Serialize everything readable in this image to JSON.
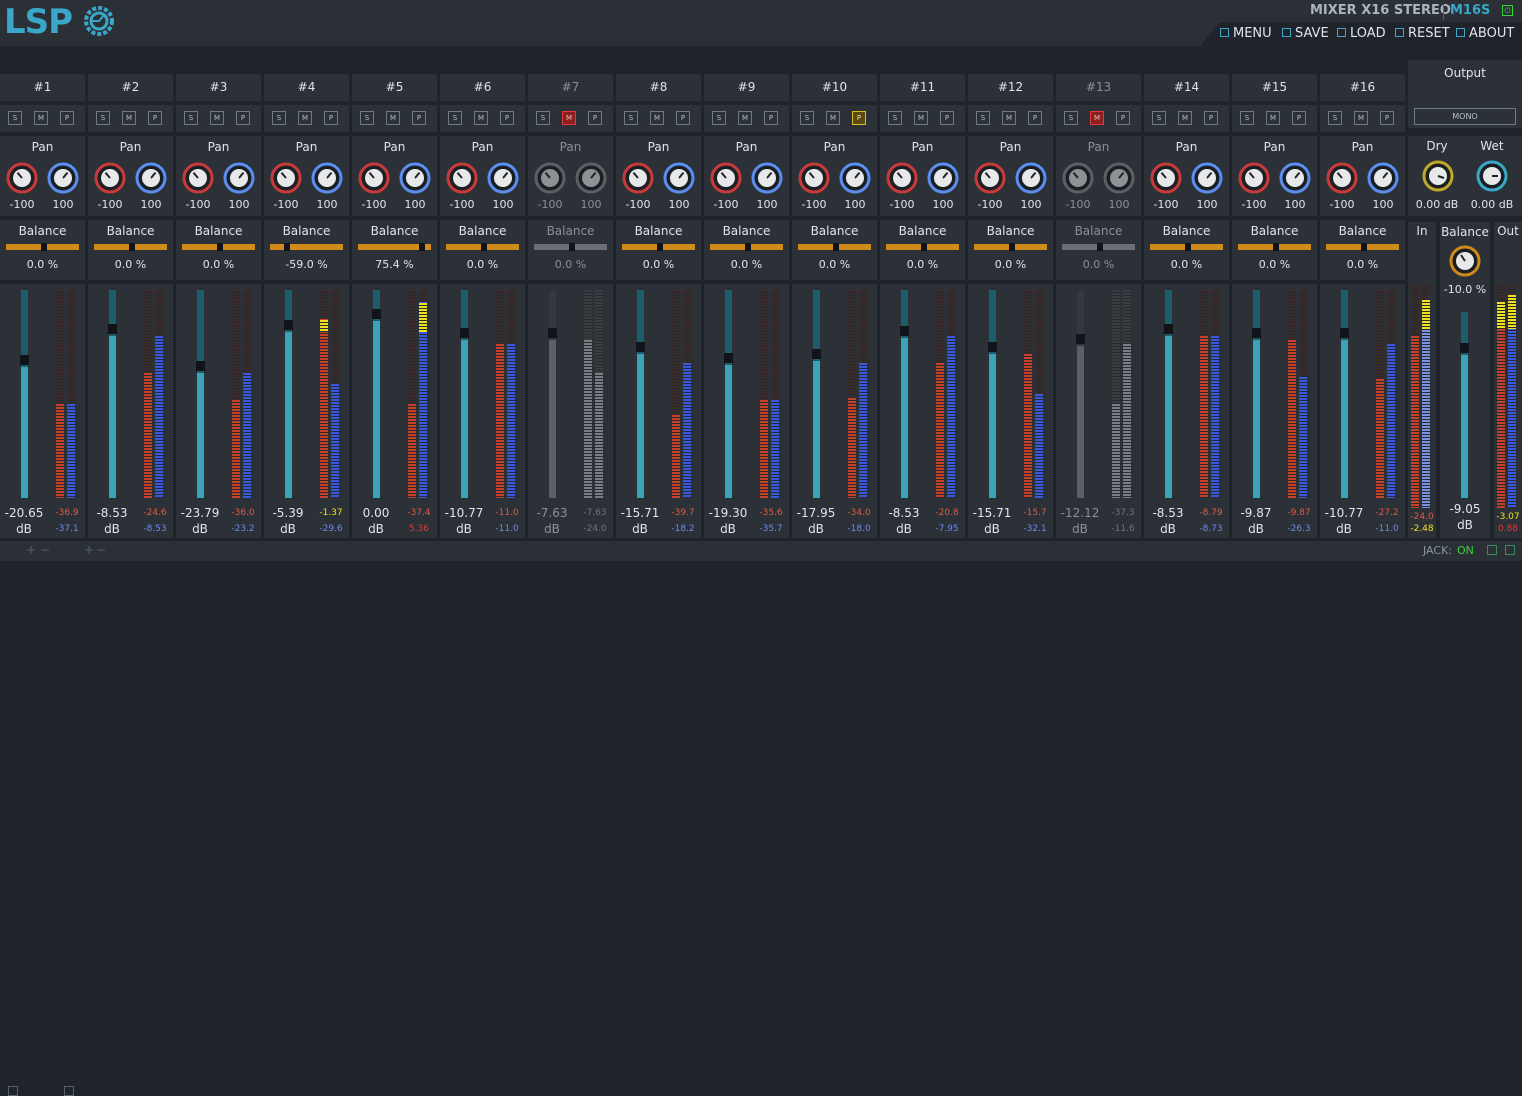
{
  "app": {
    "logo": "LSP",
    "title": "MIXER X16 STEREO",
    "model": "M16S"
  },
  "menu": {
    "menu_label": "MENU",
    "save_label": "SAVE",
    "load_label": "LOAD",
    "reset_label": "RESET",
    "about_label": "ABOUT"
  },
  "colors": {
    "accent": "#3aa7c9",
    "pan_left": "#c83a3a",
    "pan_right": "#5c8df0",
    "balance": "#d08a1a",
    "fader": "#39a3b8",
    "solo_active": "#d8c020",
    "mute_active": "#e03a3a"
  },
  "strip_buttons": {
    "solo": "S",
    "mute": "M",
    "phase": "P"
  },
  "strip_labels": {
    "pan": "Pan",
    "balance": "Balance",
    "db": "dB"
  },
  "channels": [
    {
      "name": "#1",
      "pan_l": "-100",
      "pan_r": "100",
      "balance": "0.0 %",
      "balance_frac": 0.5,
      "gain": "-20.65",
      "fader_frac": 0.63,
      "peak_l": "-36.9",
      "peak_r": "-37.1",
      "lvl_l": 0.45,
      "lvl_r": 0.45,
      "mute": false,
      "solo": false,
      "enabled": true
    },
    {
      "name": "#2",
      "pan_l": "-100",
      "pan_r": "100",
      "balance": "0.0 %",
      "balance_frac": 0.5,
      "gain": "-8.53",
      "fader_frac": 0.78,
      "peak_l": "-24.6",
      "peak_r": "-8.53",
      "lvl_l": 0.6,
      "lvl_r": 0.78,
      "mute": false,
      "solo": false,
      "enabled": true
    },
    {
      "name": "#3",
      "pan_l": "-100",
      "pan_r": "100",
      "balance": "0.0 %",
      "balance_frac": 0.5,
      "gain": "-23.79",
      "fader_frac": 0.6,
      "peak_l": "-36.0",
      "peak_r": "-23.2",
      "lvl_l": 0.47,
      "lvl_r": 0.6,
      "mute": false,
      "solo": false,
      "enabled": true
    },
    {
      "name": "#4",
      "pan_l": "-100",
      "pan_r": "100",
      "balance": "-59.0 %",
      "balance_frac": 0.2,
      "gain": "-5.39",
      "fader_frac": 0.8,
      "peak_l": "-1.37",
      "peak_r": "-29.6",
      "lvl_l": 0.86,
      "lvl_r": 0.55,
      "mute": false,
      "solo": false,
      "enabled": true
    },
    {
      "name": "#5",
      "pan_l": "-100",
      "pan_r": "100",
      "balance": "75.4 %",
      "balance_frac": 0.88,
      "gain": "0.00",
      "fader_frac": 0.85,
      "peak_l": "-37.4",
      "peak_r": "5.36",
      "lvl_l": 0.45,
      "lvl_r": 0.94,
      "mute": false,
      "solo": false,
      "enabled": true
    },
    {
      "name": "#6",
      "pan_l": "-100",
      "pan_r": "100",
      "balance": "0.0 %",
      "balance_frac": 0.5,
      "gain": "-10.77",
      "fader_frac": 0.76,
      "peak_l": "-11.0",
      "peak_r": "-11.0",
      "lvl_l": 0.74,
      "lvl_r": 0.74,
      "mute": false,
      "solo": false,
      "enabled": true
    },
    {
      "name": "#7",
      "pan_l": "-100",
      "pan_r": "100",
      "balance": "0.0 %",
      "balance_frac": 0.5,
      "gain": "-7.63",
      "fader_frac": 0.76,
      "peak_l": "-7.63",
      "peak_r": "-24.0",
      "lvl_l": 0.76,
      "lvl_r": 0.6,
      "mute": true,
      "solo": false,
      "enabled": false
    },
    {
      "name": "#8",
      "pan_l": "-100",
      "pan_r": "100",
      "balance": "0.0 %",
      "balance_frac": 0.5,
      "gain": "-15.71",
      "fader_frac": 0.69,
      "peak_l": "-39.7",
      "peak_r": "-18.2",
      "lvl_l": 0.4,
      "lvl_r": 0.65,
      "mute": false,
      "solo": false,
      "enabled": true
    },
    {
      "name": "#9",
      "pan_l": "-100",
      "pan_r": "100",
      "balance": "0.0 %",
      "balance_frac": 0.5,
      "gain": "-19.30",
      "fader_frac": 0.64,
      "peak_l": "-35.6",
      "peak_r": "-35.7",
      "lvl_l": 0.47,
      "lvl_r": 0.47,
      "mute": false,
      "solo": false,
      "enabled": true
    },
    {
      "name": "#10",
      "pan_l": "-100",
      "pan_r": "100",
      "balance": "0.0 %",
      "balance_frac": 0.5,
      "gain": "-17.95",
      "fader_frac": 0.66,
      "peak_l": "-34.0",
      "peak_r": "-18.0",
      "lvl_l": 0.48,
      "lvl_r": 0.65,
      "mute": false,
      "solo": false,
      "phase": true,
      "enabled": true
    },
    {
      "name": "#11",
      "pan_l": "-100",
      "pan_r": "100",
      "balance": "0.0 %",
      "balance_frac": 0.5,
      "gain": "-8.53",
      "fader_frac": 0.77,
      "peak_l": "-20.8",
      "peak_r": "-7.95",
      "lvl_l": 0.65,
      "lvl_r": 0.78,
      "mute": false,
      "solo": false,
      "enabled": true
    },
    {
      "name": "#12",
      "pan_l": "-100",
      "pan_r": "100",
      "balance": "0.0 %",
      "balance_frac": 0.5,
      "gain": "-15.71",
      "fader_frac": 0.69,
      "peak_l": "-15.7",
      "peak_r": "-32.1",
      "lvl_l": 0.69,
      "lvl_r": 0.5,
      "mute": false,
      "solo": false,
      "enabled": true
    },
    {
      "name": "#13",
      "pan_l": "-100",
      "pan_r": "100",
      "balance": "0.0 %",
      "balance_frac": 0.5,
      "gain": "-12.12",
      "fader_frac": 0.73,
      "peak_l": "-37.3",
      "peak_r": "-11.6",
      "lvl_l": 0.45,
      "lvl_r": 0.74,
      "mute": true,
      "solo": false,
      "enabled": false
    },
    {
      "name": "#14",
      "pan_l": "-100",
      "pan_r": "100",
      "balance": "0.0 %",
      "balance_frac": 0.5,
      "gain": "-8.53",
      "fader_frac": 0.78,
      "peak_l": "-8.79",
      "peak_r": "-8.73",
      "lvl_l": 0.78,
      "lvl_r": 0.78,
      "mute": false,
      "solo": false,
      "enabled": true
    },
    {
      "name": "#15",
      "pan_l": "-100",
      "pan_r": "100",
      "balance": "0.0 %",
      "balance_frac": 0.5,
      "gain": "-9.87",
      "fader_frac": 0.76,
      "peak_l": "-9.87",
      "peak_r": "-26.3",
      "lvl_l": 0.76,
      "lvl_r": 0.58,
      "mute": false,
      "solo": false,
      "enabled": true
    },
    {
      "name": "#16",
      "pan_l": "-100",
      "pan_r": "100",
      "balance": "0.0 %",
      "balance_frac": 0.5,
      "gain": "-10.77",
      "fader_frac": 0.76,
      "peak_l": "-27.2",
      "peak_r": "-11.0",
      "lvl_l": 0.57,
      "lvl_r": 0.74,
      "mute": false,
      "solo": false,
      "enabled": true
    }
  ],
  "output": {
    "title": "Output",
    "mono_label": "MONO",
    "dry_label": "Dry",
    "wet_label": "Wet",
    "dry_value": "0.00 dB",
    "wet_value": "0.00 dB",
    "in_label": "In",
    "out_label": "Out",
    "balance_label": "Balance",
    "balance_value": "-10.0 %",
    "gain": "-9.05",
    "db_label": "dB",
    "fader_frac": 0.77,
    "in_peak_l": "-24.0",
    "in_peak_r": "-2.48",
    "out_peak_l": "-3.07",
    "out_peak_r": "0.88",
    "in_lvl_l": 0.77,
    "in_lvl_r": 0.93,
    "out_lvl_l": 0.92,
    "out_lvl_r": 0.95
  },
  "status": {
    "jack_label": "JACK:",
    "jack_state": "ON"
  }
}
